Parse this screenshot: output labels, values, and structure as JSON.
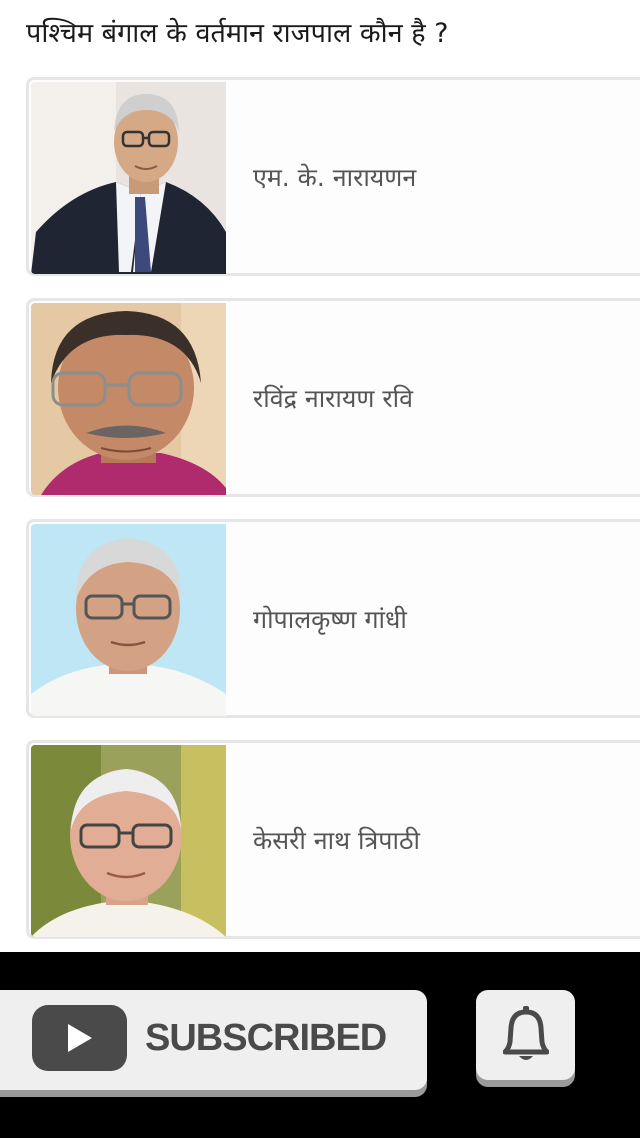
{
  "question": "पश्चिम बंगाल के वर्तमान राजपाल कौन है  ?",
  "options": [
    {
      "label": "एम. के. नारायणन",
      "photo": "portrait-elderly-man-glasses-suit"
    },
    {
      "label": "रविंद्र नारायण रवि",
      "photo": "portrait-man-glasses-moustache-magenta-kurta"
    },
    {
      "label": "गोपालकृष्ण गांधी",
      "photo": "portrait-elderly-man-glasses-white-kurta"
    },
    {
      "label": "केसरी नाथ त्रिपाठी",
      "photo": "portrait-elderly-bald-man-glasses"
    }
  ],
  "subscribe": {
    "label": "SUBSCRIBED",
    "icon": "youtube-play-icon"
  },
  "bell": {
    "icon": "bell-icon"
  },
  "colors": {
    "card_border": "#e6e6e6",
    "option_text": "#555555",
    "button_bg": "#efefef",
    "button_text": "#4a4a4a",
    "bottom_bar": "#000000"
  }
}
